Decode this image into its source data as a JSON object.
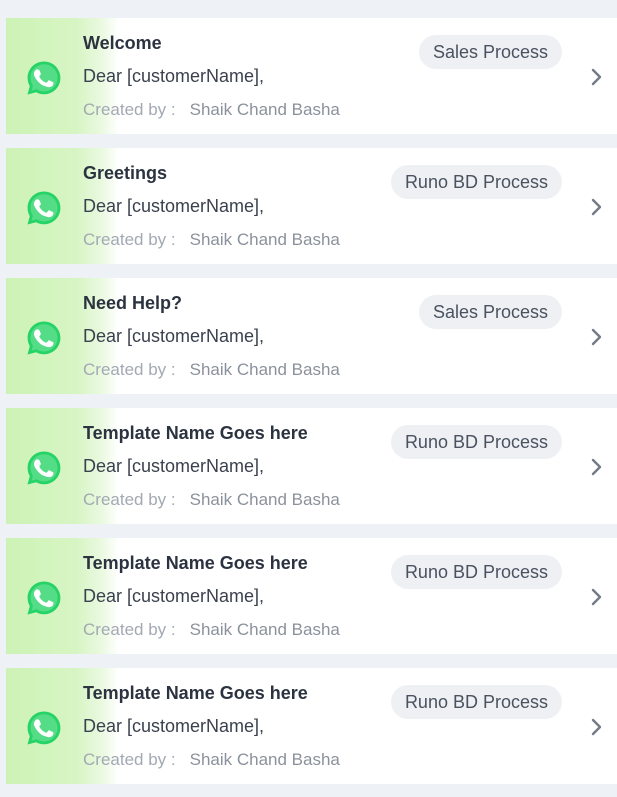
{
  "colors": {
    "whatsapp_green": "#25d366",
    "card_accent": "#cdf2b6",
    "tag_background": "#eef0f4"
  },
  "template_list": {
    "icon": "whatsapp-icon",
    "items": [
      {
        "title": "Welcome",
        "tag": "Sales Process",
        "greeting": "Dear [customerName],",
        "created_label": "Created by :",
        "author": "Shaik Chand Basha"
      },
      {
        "title": "Greetings",
        "tag": "Runo BD Process",
        "greeting": "Dear [customerName],",
        "created_label": "Created by :",
        "author": "Shaik Chand Basha"
      },
      {
        "title": "Need Help?",
        "tag": "Sales Process",
        "greeting": "Dear [customerName],",
        "created_label": "Created by :",
        "author": "Shaik Chand Basha"
      },
      {
        "title": "Template Name Goes here",
        "tag": "Runo BD Process",
        "greeting": "Dear [customerName],",
        "created_label": "Created by :",
        "author": "Shaik Chand Basha"
      },
      {
        "title": "Template Name Goes here",
        "tag": "Runo BD Process",
        "greeting": "Dear [customerName],",
        "created_label": "Created by :",
        "author": "Shaik Chand Basha"
      },
      {
        "title": "Template Name Goes here",
        "tag": "Runo BD Process",
        "greeting": "Dear [customerName],",
        "created_label": "Created by :",
        "author": "Shaik Chand Basha"
      }
    ]
  }
}
